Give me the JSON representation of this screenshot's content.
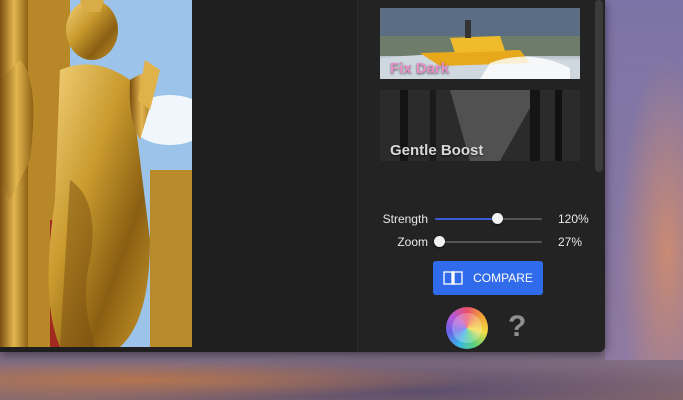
{
  "desktop": {
    "colors": {
      "app_background": "#1f1f1f",
      "accent": "#2f6bea"
    }
  },
  "photo": {
    "subject": "golden-buddha-statue"
  },
  "presets": [
    {
      "label": "Fix Dark",
      "label_color": "#e68fc6"
    },
    {
      "label": "Gentle Boost",
      "label_color": "#d9d9d9"
    }
  ],
  "sliders": [
    {
      "label": "Strength",
      "value_text": "120%",
      "fraction": 0.58
    },
    {
      "label": "Zoom",
      "value_text": "27%",
      "fraction": 0.04
    }
  ],
  "compare": {
    "label": "COMPARE",
    "icon": "compare-icon"
  },
  "footer": {
    "logo_icon": "app-logo-icon",
    "help_label": "?"
  }
}
